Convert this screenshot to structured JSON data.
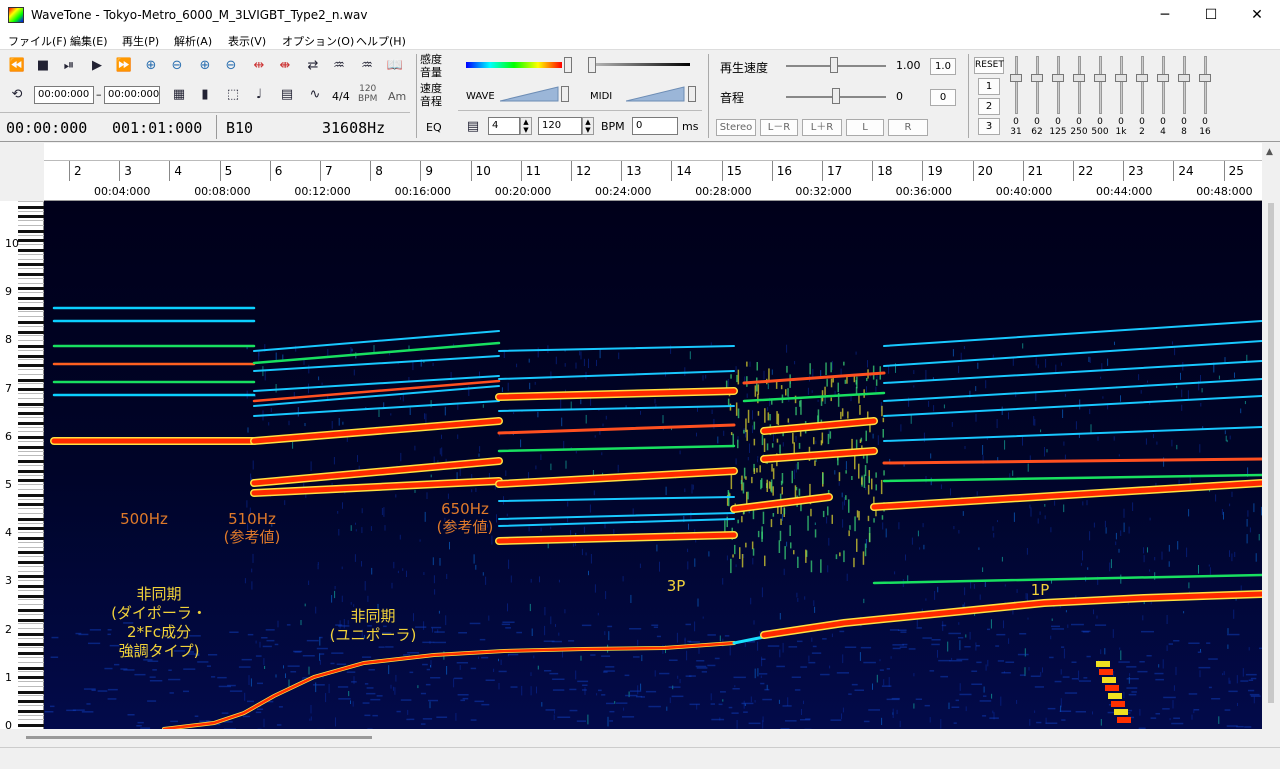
{
  "window": {
    "title": "WaveTone - Tokyo-Metro_6000_M_3LVIGBT_Type2_n.wav",
    "minimize": "─",
    "maximize": "☐",
    "close": "✕"
  },
  "menu": [
    "ファイル(F)",
    "編集(E)",
    "再生(P)",
    "解析(A)",
    "表示(V)",
    "オプション(O)",
    "ヘルプ(H)"
  ],
  "toolbar": {
    "range_start": "00:00:000",
    "range_sep": "–",
    "range_end": "00:00:000",
    "time_sig": "4/4",
    "bpm_small_top": "120",
    "bpm_small_bot": "BPM",
    "chord_label": "Am",
    "position": "00:00:000",
    "measure": "001:01:000",
    "note": "B10",
    "frequency": "31608Hz",
    "sensitivity_label": "感度",
    "volume_label": "音量",
    "speed_label": "速度",
    "pitch_label2": "音程",
    "wave_label": "WAVE",
    "midi_label": "MIDI",
    "eq_label": "EQ",
    "beats_value": "4",
    "bpm_value": "120",
    "bpm_label": "BPM",
    "ms_value": "0",
    "ms_label": "ms",
    "playback_speed_label": "再生速度",
    "playback_speed_value": "1.00",
    "playback_speed_reset": "1.0",
    "pitch_label": "音程",
    "pitch_value": "0",
    "pitch_reset": "0",
    "stereo_label": "Stereo",
    "lr_minus": "L－R",
    "lr_plus": "L＋R",
    "l_btn": "L",
    "r_btn": "R",
    "eq_reset": "RESET",
    "eq_presets": [
      "1",
      "2",
      "3"
    ],
    "eq_bands": [
      "31",
      "62",
      "125",
      "250",
      "500",
      "1k",
      "2",
      "4",
      "8",
      "16"
    ],
    "eq_values": [
      "0",
      "0",
      "0",
      "0",
      "0",
      "0",
      "0",
      "0",
      "0",
      "0"
    ]
  },
  "ruler": {
    "measures": [
      "2",
      "3",
      "4",
      "5",
      "6",
      "7",
      "8",
      "9",
      "10",
      "11",
      "12",
      "13",
      "14",
      "15",
      "16",
      "17",
      "18",
      "19",
      "20",
      "21",
      "22",
      "23",
      "24",
      "25"
    ],
    "times": [
      "00:04:000",
      "00:08:000",
      "00:12:000",
      "00:16:000",
      "00:20:000",
      "00:24:000",
      "00:28:000",
      "00:32:000",
      "00:36:000",
      "00:40:000",
      "00:44:000",
      "00:48:000"
    ]
  },
  "piano": {
    "octaves": [
      "10",
      "9",
      "8",
      "7",
      "6",
      "5",
      "4",
      "3",
      "2",
      "1",
      "0"
    ]
  },
  "annotations": {
    "hz500": "500Hz",
    "hz510": "510Hz",
    "hz510_ref": "(参考値)",
    "hz650": "650Hz",
    "hz650_ref": "(参考値)",
    "async1_l1": "非同期",
    "async1_l2": "(ダイポーラ・",
    "async1_l3": "2*Fc成分",
    "async1_l4": "強調タイプ)",
    "async2_l1": "非同期",
    "async2_l2": "(ユニポーラ)",
    "p3": "3P",
    "p1": "1P"
  },
  "colors": {
    "spectrogram_bg": "#000010",
    "annotation_orange": "#e07a2a",
    "annotation_yellow": "#f2d33a",
    "hot": "#ff2a00"
  }
}
